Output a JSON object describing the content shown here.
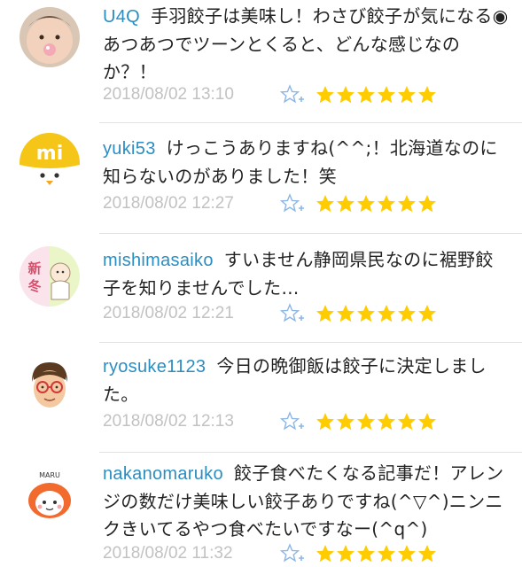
{
  "colors": {
    "username": "#2a8ec2",
    "body_text": "#222222",
    "timestamp": "#c2c2c2",
    "star": "#ffcc00",
    "fav_outline": "#8cb6e6",
    "divider": "#e2e2e2"
  },
  "comments": [
    {
      "username": "U4Q",
      "text": "手羽餃子は美味し！わさび餃子が気になる◉あつあつでツーンとくると、どんな感じなのか？！",
      "timestamp": "2018/08/02 13:10",
      "star_count": 6,
      "avatar": "baby-photo"
    },
    {
      "username": "yuki53",
      "text": "けっこうありますね(^^;！北海道なのに知らないのがありました！笑",
      "timestamp": "2018/08/02 12:27",
      "star_count": 6,
      "avatar": "chick-mi-logo"
    },
    {
      "username": "mishimasaiko",
      "text": "すいません静岡県民なのに裾野餃子を知りませんでした…",
      "timestamp": "2018/08/02 12:21",
      "star_count": 6,
      "avatar": "shinto-baby-illustration"
    },
    {
      "username": "ryosuke1123",
      "text": "今日の晩御飯は餃子に決定しました。",
      "timestamp": "2018/08/02 12:13",
      "star_count": 6,
      "avatar": "glasses-man-avatar"
    },
    {
      "username": "nakanomaruko",
      "text": "餃子食べたくなる記事だ！アレンジの数だけ美味しい餃子ありですね(^▽^)ニンニクきいてるやつ食べたいですなー(^q^)",
      "timestamp": "2018/08/02 11:32",
      "star_count": 6,
      "avatar": "maru-girl-illustration"
    }
  ]
}
